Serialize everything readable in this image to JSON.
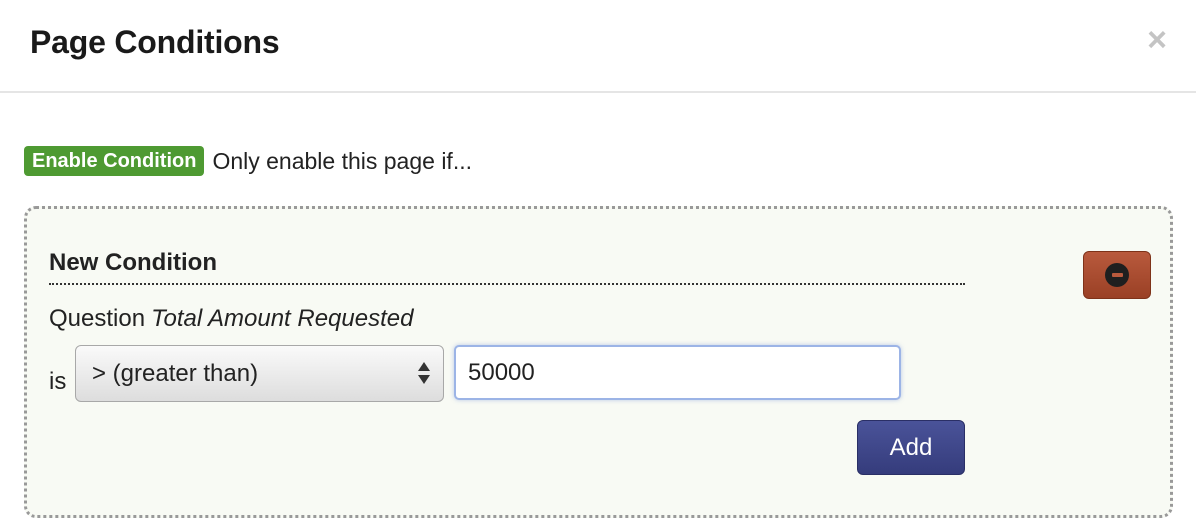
{
  "modal": {
    "title": "Page Conditions",
    "close_label": "×"
  },
  "enable": {
    "badge": "Enable Condition",
    "text": "Only enable this page if..."
  },
  "condition": {
    "title": "New Condition",
    "question_prefix": "Question",
    "question_name": "Total Amount Requested",
    "is_label": "is",
    "operator_selected": "> (greater than)",
    "value": "50000",
    "add_label": "Add",
    "remove_icon": "minus-circle-icon"
  },
  "colors": {
    "enable_badge": "#4e9a32",
    "remove_button": "#a84c31",
    "add_button": "#3f4789",
    "box_background": "#f8faf4"
  }
}
